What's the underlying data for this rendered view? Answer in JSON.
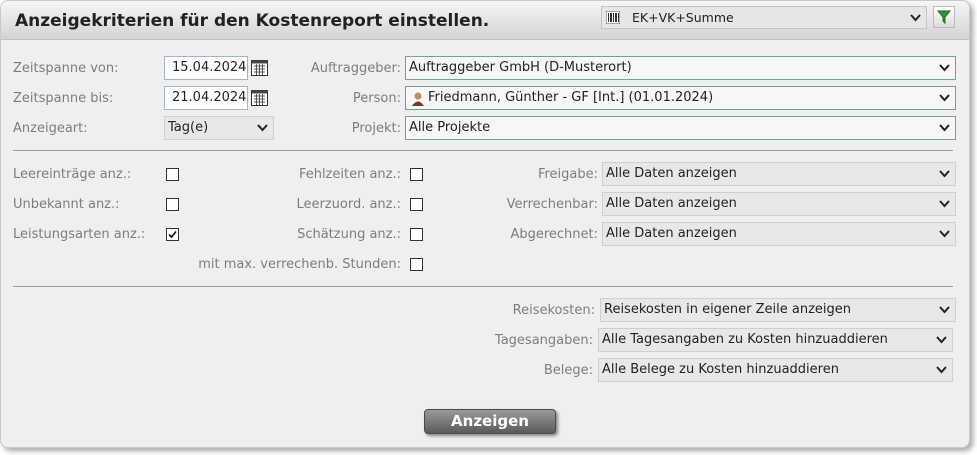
{
  "header": {
    "title": "Anzeigekriterien für den Kostenreport einstellen.",
    "report_type": "EK+VK+Summe",
    "icons": {
      "lead": "barcode-icon",
      "filter": "filter-icon"
    }
  },
  "row1": {
    "zeitspanne_von_label": "Zeitspanne von:",
    "zeitspanne_von_value": "15.04.2024",
    "zeitspanne_bis_label": "Zeitspanne bis:",
    "zeitspanne_bis_value": "21.04.2024",
    "anzeigeart_label": "Anzeigeart:",
    "anzeigeart_value": "Tag(e)",
    "auftraggeber_label": "Auftraggeber:",
    "auftraggeber_value": "Auftraggeber GmbH (D-Musterort)",
    "person_label": "Person:",
    "person_value": "Friedmann, Günther - GF [Int.] (01.01.2024)",
    "projekt_label": "Projekt:",
    "projekt_value": "Alle Projekte"
  },
  "options": {
    "leereintraege_label": "Leereinträge anz.:",
    "leereintraege_checked": false,
    "unbekannt_label": "Unbekannt anz.:",
    "unbekannt_checked": false,
    "leistungsarten_label": "Leistungsarten anz.:",
    "leistungsarten_checked": true,
    "fehlzeiten_label": "Fehlzeiten anz.:",
    "fehlzeiten_checked": false,
    "leerzuord_label": "Leerzuord. anz.:",
    "leerzuord_checked": false,
    "schaetzung_label": "Schätzung anz.:",
    "schaetzung_checked": false,
    "max_stunden_label": "mit max. verrechenb. Stunden:",
    "max_stunden_checked": false,
    "freigabe_label": "Freigabe:",
    "freigabe_value": "Alle Daten anzeigen",
    "verrechenbar_label": "Verrechenbar:",
    "verrechenbar_value": "Alle Daten anzeigen",
    "abgerechnet_label": "Abgerechnet:",
    "abgerechnet_value": "Alle Daten anzeigen"
  },
  "costs": {
    "reisekosten_label": "Reisekosten:",
    "reisekosten_value": "Reisekosten in eigener Zeile anzeigen",
    "tagesangaben_label": "Tagesangaben:",
    "tagesangaben_value": "Alle Tagesangaben zu Kosten hinzuaddieren",
    "belege_label": "Belege:",
    "belege_value": "Alle Belege zu Kosten hinzuaddieren"
  },
  "actions": {
    "show_label": "Anzeigen"
  },
  "colors": {
    "accent_border": "#6aa88a",
    "filter_green": "#2e9a2e"
  }
}
